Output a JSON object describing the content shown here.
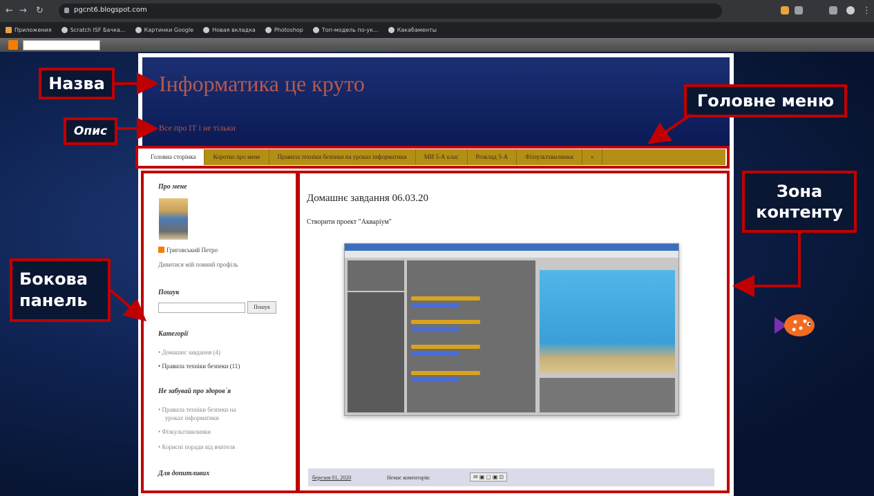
{
  "browser": {
    "url": "pgcnt6.blogspot.com",
    "back_icon": "arrow-left-icon",
    "forward_icon": "arrow-right-icon",
    "reload_icon": "reload-icon",
    "bookmarks": [
      {
        "label": "Приложения"
      },
      {
        "label": "Scratch ISF Бачка..."
      },
      {
        "label": "Картинки Google"
      },
      {
        "label": "Новая вкладка"
      },
      {
        "label": "Photoshop"
      },
      {
        "label": "Топ-модель по-ук..."
      },
      {
        "label": "Какабаменты"
      }
    ]
  },
  "blog": {
    "title": "Інформатика це круто",
    "description": "Все про ІТ і не тільки",
    "menu": [
      {
        "label": "Головна сторінка"
      },
      {
        "label": "Коротко про мене"
      },
      {
        "label": "Правила техніки безпеки на уроках інформатики"
      },
      {
        "label": "МИ 5-А клас"
      },
      {
        "label": "Розклад 5-А"
      },
      {
        "label": "Фіззультхвилинки"
      }
    ],
    "menu_more": "»",
    "sidebar": {
      "about_title": "Про мене",
      "author": "Григовський Петро",
      "profile_link": "Дивитися мій повний профіль",
      "search_title": "Пошук",
      "search_button": "Пошук",
      "categories_title": "Категорії",
      "categories": [
        {
          "label": "Домашнє завдання (4)"
        },
        {
          "label": "Правила техніки безпеки (11)"
        }
      ],
      "health_title": "Не забувай про здоров`я",
      "health_links": [
        {
          "label": "Правила техніки безпеки на"
        },
        {
          "label": "уроках інформатики"
        },
        {
          "label": "Фізкультхвилинки"
        },
        {
          "label": "Корисні поради від вчителя"
        }
      ],
      "extra_title": "Для допитливих"
    },
    "post": {
      "title": "Домашнє завдання 06.03.20",
      "text": "Створити проект \"Акваріум\"",
      "date": "березня 01, 2020",
      "comments": "Немає коментарів:"
    }
  },
  "annotations": {
    "title_label": "Назва",
    "description_label": "Опис",
    "menu_label": "Головне меню",
    "content_label_1": "Зона",
    "content_label_2": "контенту",
    "sidebar_label_1": "Бокова",
    "sidebar_label_2": "панель"
  },
  "colors": {
    "annotation_red": "#c00000",
    "header_blue": "#1b2f73",
    "menu_gold": "#b38f15",
    "title_red": "#b35a4f"
  }
}
